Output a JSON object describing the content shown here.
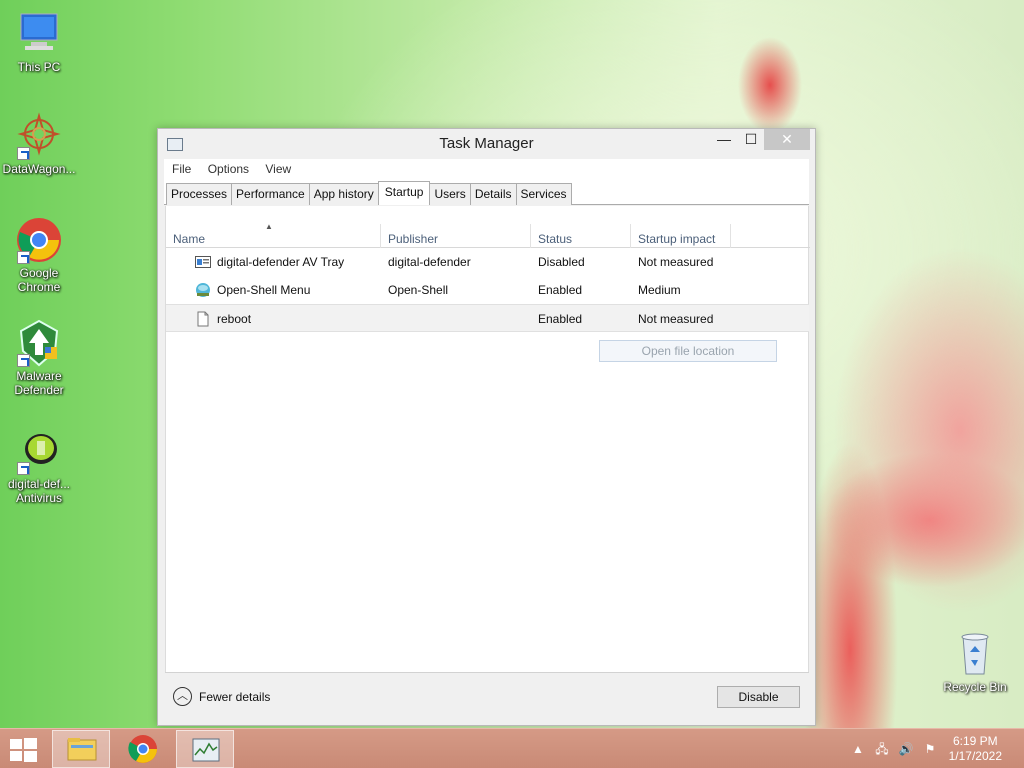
{
  "desktop": {
    "icons": [
      {
        "label": "This PC",
        "icon": "computer-icon"
      },
      {
        "label": "DataWagon...",
        "icon": "datawagon-icon"
      },
      {
        "label": "Google Chrome",
        "icon": "chrome-icon"
      },
      {
        "label": "Malware Defender",
        "icon": "shield-icon"
      },
      {
        "label": "digital-def... Antivirus",
        "icon": "antivirus-icon"
      },
      {
        "label": "Recycle Bin",
        "icon": "recycle-bin-icon"
      }
    ]
  },
  "window": {
    "title": "Task Manager",
    "buttons": {
      "minimize": "—",
      "maximize": "☐",
      "close": "✕"
    },
    "menu": [
      "File",
      "Options",
      "View"
    ],
    "tabs": [
      "Processes",
      "Performance",
      "App history",
      "Startup",
      "Users",
      "Details",
      "Services"
    ],
    "active_tab": "Startup",
    "columns": [
      "Name",
      "Publisher",
      "Status",
      "Startup impact"
    ],
    "rows": [
      {
        "name": "digital-defender AV Tray",
        "publisher": "digital-defender",
        "status": "Disabled",
        "impact": "Not measured",
        "icon": "tray-app-icon"
      },
      {
        "name": "Open-Shell Menu",
        "publisher": "Open-Shell",
        "status": "Enabled",
        "impact": "Medium",
        "icon": "open-shell-icon"
      },
      {
        "name": "reboot",
        "publisher": "",
        "status": "Enabled",
        "impact": "Not measured",
        "icon": "file-icon"
      }
    ],
    "selected_row": 2,
    "open_file_location": "Open file location",
    "fewer_details": "Fewer details",
    "disable_button": "Disable"
  },
  "taskbar": {
    "time": "6:19 PM",
    "date": "1/17/2022",
    "items": [
      "file-explorer-icon",
      "chrome-icon",
      "task-manager-icon"
    ]
  },
  "colors": {
    "taskbar": "#c98a76",
    "accent": "#4c607a"
  }
}
